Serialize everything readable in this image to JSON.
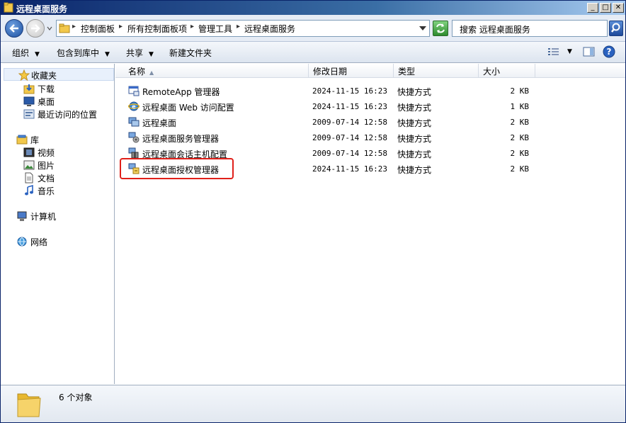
{
  "window": {
    "title": "远程桌面服务"
  },
  "address": {
    "crumbs": [
      "控制面板",
      "所有控制面板项",
      "管理工具",
      "远程桌面服务"
    ]
  },
  "search": {
    "text": "搜索 远程桌面服务"
  },
  "toolbar": {
    "organize": "组织",
    "include_in_library": "包含到库中",
    "share": "共享",
    "new_folder": "新建文件夹"
  },
  "navpane": {
    "favorites": "收藏夹",
    "downloads": "下载",
    "desktop": "桌面",
    "recent": "最近访问的位置",
    "libraries": "库",
    "videos": "视频",
    "pictures": "图片",
    "documents": "文档",
    "music": "音乐",
    "computer": "计算机",
    "network": "网络"
  },
  "columns": {
    "name": "名称",
    "date": "修改日期",
    "type": "类型",
    "size": "大小"
  },
  "files": [
    {
      "name": "RemoteApp 管理器",
      "date": "2024-11-15 16:23",
      "type": "快捷方式",
      "size": "2 KB",
      "icon": "remoteapp-icon"
    },
    {
      "name": "远程桌面 Web 访问配置",
      "date": "2024-11-15 16:23",
      "type": "快捷方式",
      "size": "1 KB",
      "icon": "ie-web-icon"
    },
    {
      "name": "远程桌面",
      "date": "2009-07-14 12:58",
      "type": "快捷方式",
      "size": "2 KB",
      "icon": "remote-desktop-icon"
    },
    {
      "name": "远程桌面服务管理器",
      "date": "2009-07-14 12:58",
      "type": "快捷方式",
      "size": "2 KB",
      "icon": "services-manager-icon"
    },
    {
      "name": "远程桌面会话主机配置",
      "date": "2009-07-14 12:58",
      "type": "快捷方式",
      "size": "2 KB",
      "icon": "session-host-icon"
    },
    {
      "name": "远程桌面授权管理器",
      "date": "2024-11-15 16:23",
      "type": "快捷方式",
      "size": "2 KB",
      "icon": "licensing-manager-icon"
    }
  ],
  "status": {
    "count": "6 个对象"
  }
}
